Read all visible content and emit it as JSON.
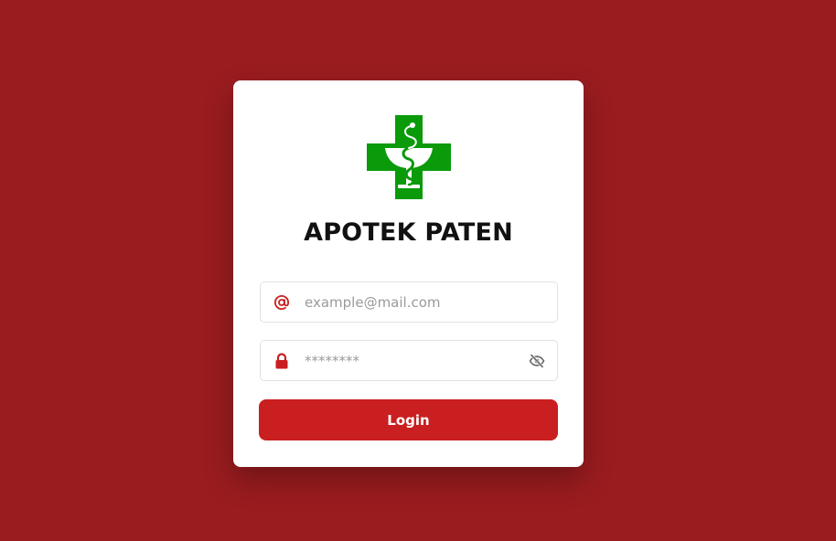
{
  "app": {
    "brand_name": "APOTEK PATEN",
    "logo_icon": "pharmacy-cross-icon"
  },
  "form": {
    "email": {
      "icon": "at-icon",
      "value": "",
      "placeholder": "example@mail.com"
    },
    "password": {
      "icon": "lock-icon",
      "value": "",
      "placeholder": "********",
      "toggle_icon": "eye-off-icon"
    },
    "login_label": "Login"
  },
  "colors": {
    "background": "#9a1c1f",
    "card": "#ffffff",
    "accent": "#c91f21",
    "logo_green": "#0a9a0a",
    "icon_red": "#c91f21",
    "icon_gray": "#6b6b6b"
  }
}
